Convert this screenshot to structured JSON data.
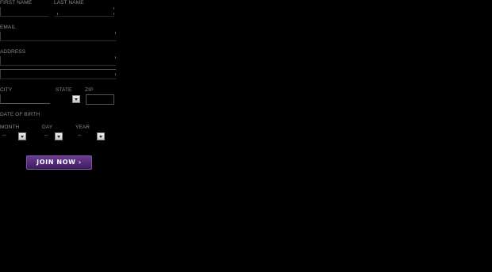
{
  "form": {
    "first_name_label": "FIRST NAME",
    "last_name_label": "LAST NAME",
    "email_label": "EMAIL",
    "address_label": "ADDRESS",
    "city_label": "CITY",
    "state_label": "STATE",
    "zip_label": "ZIP",
    "dob_label": "DATE OF BIRTH",
    "month_label": "MONTH",
    "day_label": "DAY",
    "year_label": "YEAR",
    "month_value": "--",
    "day_value": "--",
    "year_value": "--",
    "join_button": "JOIN NOW ›"
  },
  "colors": {
    "background": "#000000",
    "label_text": "#8a8a8a",
    "button_purple": "#5a2d82"
  },
  "icons": {
    "dropdown": "chevron-down-icon"
  }
}
